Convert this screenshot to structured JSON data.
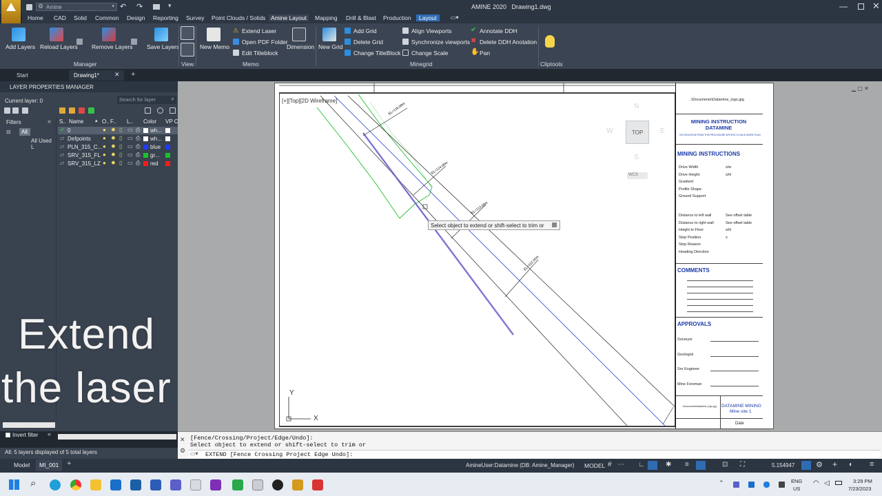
{
  "titlebar": {
    "workspace": "Amine",
    "app_title": "AMINE 2020",
    "document_title": "Drawing1.dwg"
  },
  "ribbon_tabs": [
    "Home",
    "CAD",
    "Solid",
    "Common",
    "Design",
    "Reporting",
    "Survey",
    "Point Clouds / Solids",
    "Amine Layout",
    "Mapping",
    "Drill & Blast",
    "Production",
    "Layout"
  ],
  "ribbon": {
    "add_layers": "Add Layers",
    "reload_layers": "Reload Layers",
    "remove_layers": "Remove Layers",
    "save_layers": "Save Layers",
    "new_memo": "New Memo",
    "extend_laser": "Extend Laser",
    "open_pdf_folder": "Open PDF Folder",
    "edit_titleblock": "Edit Titleblock",
    "dimension": "Dimension",
    "new_grid": "New Grid",
    "add_grid": "Add Grid",
    "delete_grid": "Delete Grid",
    "change_titleblock": "Change TitleBlock",
    "align_viewports": "Align Viewports",
    "synchronize_viewports": "Synchronize viewports",
    "change_scale": "Change Scale",
    "annotate_ddh": "Annotate DDH",
    "delete_ddh_anotation": "Delete DDH Anotation",
    "pan": "Pan",
    "cliptools": "Cliptools",
    "panels": {
      "manager": "Manager",
      "view": "View",
      "memo": "Memo",
      "minegrid": "Minegrid"
    }
  },
  "doc_tabs": {
    "start": "Start",
    "drawing": "Drawing1*"
  },
  "lpm": {
    "title": "LAYER PROPERTIES MANAGER",
    "current_layer": "Current layer: 0",
    "search_placeholder": "Search for layer",
    "filters_label": "Filters",
    "filter_all": "All",
    "filter_all_used": "All Used L",
    "columns": [
      "S..",
      "Name",
      "O..",
      "F..",
      "L..",
      "Color",
      "VP C"
    ],
    "layers": [
      {
        "name": "0",
        "color_name": "wh...",
        "color": "#ffffff"
      },
      {
        "name": "Defpoints",
        "color_name": "wh...",
        "color": "#ffffff"
      },
      {
        "name": "PLN_315_C...",
        "color_name": "blue",
        "color": "#1d3cff"
      },
      {
        "name": "SRV_315_FL",
        "color_name": "gr...",
        "color": "#16c42a"
      },
      {
        "name": "SRV_315_LZ",
        "color_name": "red",
        "color": "#ff1a1a"
      }
    ],
    "invert_filter": "Invert filter",
    "status": "All: 5 layers displayed of 5 total layers"
  },
  "overlay_text": {
    "line1": "Extend",
    "line2": "the laser"
  },
  "viewport": {
    "label": "[+][Top][2D Wireframe]",
    "tooltip": "Select object to extend or shift-select to trim or",
    "viewcube": {
      "top": "TOP",
      "n": "N",
      "s": "S",
      "e": "E",
      "w": "W",
      "wcs": "WCS"
    }
  },
  "titleblock": {
    "logo_path": "..\\Documents\\Datamine_logo.jpg",
    "heading": "MINING INSTRUCTION DATAMINE",
    "subheading": "NO DEVIATION FROM THIS PROCEDURE WITHOUT A VALID WORK PLAN",
    "instructions_heading": "MINING INSTRUCTIONS",
    "instruction_rows": [
      [
        "Drive Width",
        "s/w"
      ],
      [
        "Drive Height",
        "s/H"
      ],
      [
        "Gradient",
        ""
      ],
      [
        "Profile Shape",
        ""
      ],
      [
        "Ground Support",
        ""
      ]
    ],
    "distance_rows": [
      [
        "Distance to left wall",
        "See offset table"
      ],
      [
        "Distance to right wall",
        "See offset table"
      ],
      [
        "Height to Floor",
        "s/H"
      ],
      [
        "Stop Position",
        "s"
      ],
      [
        "Stop Reason",
        ""
      ],
      [
        "Heading Direction",
        ""
      ]
    ],
    "comments_heading": "COMMENTS",
    "approvals_heading": "APPROVALS",
    "approvals": [
      "Surveyor",
      "Geologist",
      "Snr Engineer",
      "Mine Foreman"
    ],
    "company": "DATAMINE MINING",
    "site": "Mine site 1",
    "date_label": "Date",
    "footer_small": "..\\Documents\\Datamine_logo.jpg"
  },
  "cmd": {
    "line1": "[Fence/Crossing/Project/Edge/Undo]:",
    "line2": "Select object to extend or shift-select to trim or",
    "prompt": "EXTEND [Fence Crossing Project Edge Undo]:"
  },
  "statusbar": {
    "model_tab": "Model",
    "layout_tab": "MI_001",
    "user": "AmineUser:Datamine (DB: Amine_Manager)",
    "model": "MODEL",
    "scale": "5.154947"
  },
  "taskbar": {
    "lang1": "ENG",
    "lang2": "US",
    "time": "3:29 PM",
    "date": "7/23/2023"
  }
}
